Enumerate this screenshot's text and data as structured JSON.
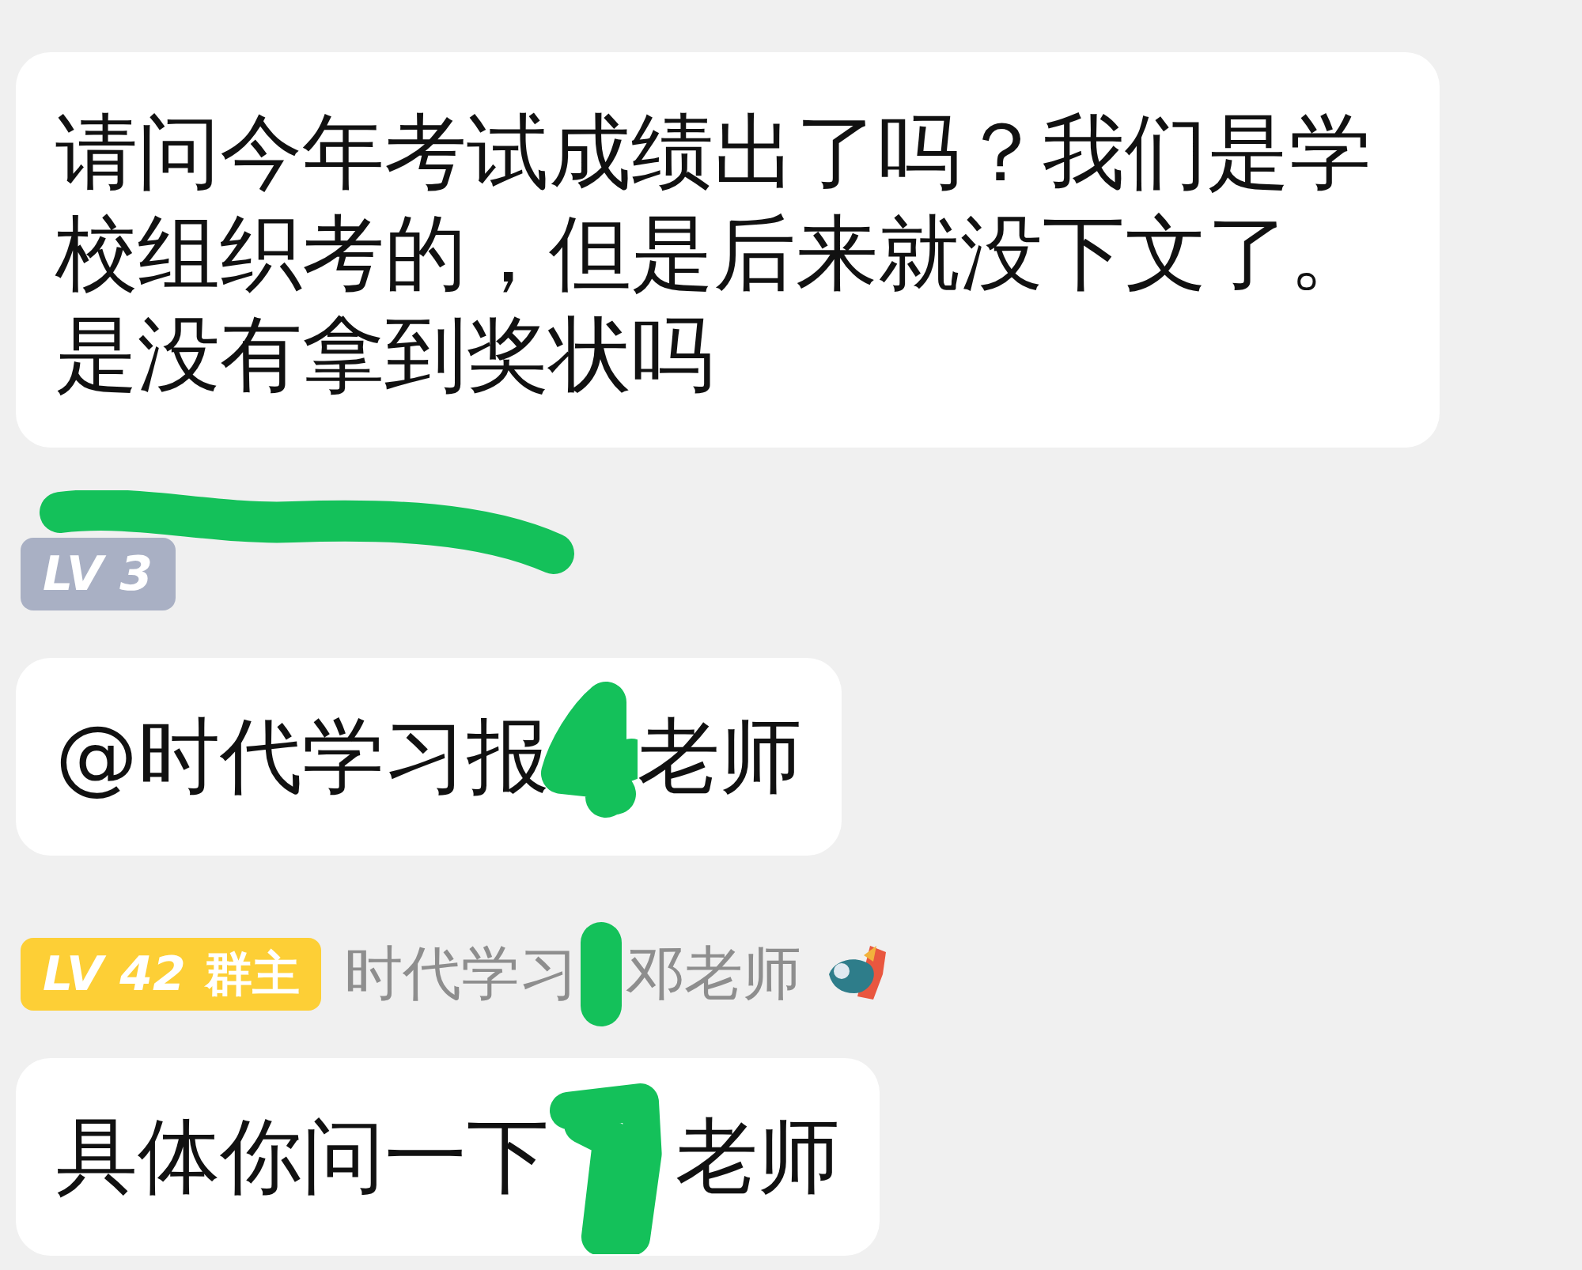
{
  "messages": [
    {
      "text_parts": [
        "请问今年考试成绩出了吗？我们是学校组织考的，但是后来就没下文了。是没有拿到奖状吗"
      ]
    },
    {
      "badge": {
        "label": "LV 3",
        "kind": "member"
      },
      "name_redacted": true,
      "text_parts": [
        "@时代学习报",
        "老师"
      ]
    },
    {
      "badge": {
        "label": "LV 42",
        "role": "群主",
        "kind": "owner"
      },
      "name_parts": [
        "时代学习",
        "邓老师"
      ],
      "name_icon": true,
      "text_parts": [
        "具体你问一下",
        "老师"
      ]
    }
  ]
}
